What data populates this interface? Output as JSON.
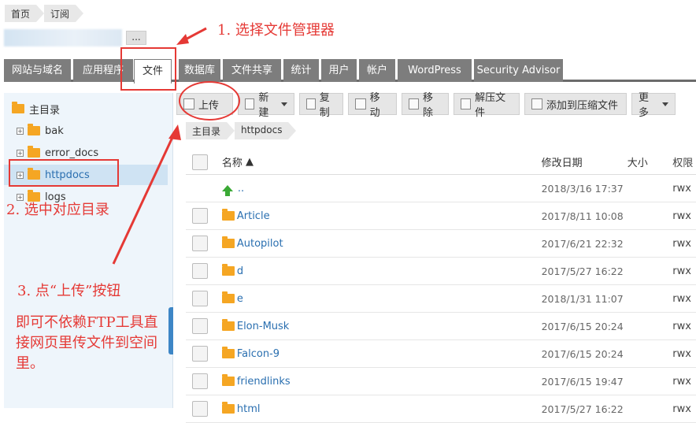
{
  "breadcrumb": [
    "首页",
    "订阅"
  ],
  "domain_more": "...",
  "tabs": [
    "网站与域名",
    "应用程序",
    "文件",
    "数据库",
    "文件共享",
    "统计",
    "用户",
    "帐户",
    "WordPress",
    "Security Advisor"
  ],
  "active_tab": "文件",
  "tree": {
    "root": "主目录",
    "items": [
      {
        "label": "bak"
      },
      {
        "label": "error_docs"
      },
      {
        "label": "httpdocs"
      },
      {
        "label": "logs"
      }
    ]
  },
  "toolbar": {
    "upload": "上传",
    "new": "新建",
    "copy": "复制",
    "move": "移动",
    "remove": "移除",
    "extract": "解压文件",
    "archive": "添加到压缩文件",
    "more": "更多"
  },
  "path": [
    "主目录",
    "httpdocs"
  ],
  "columns": {
    "name": "名称",
    "date": "修改日期",
    "size": "大小",
    "perm": "权限"
  },
  "rows": [
    {
      "name": "..",
      "date": "2018/3/16 17:37",
      "perm": "rwx"
    },
    {
      "name": "Article",
      "date": "2017/8/11 10:08",
      "perm": "rwx"
    },
    {
      "name": "Autopilot",
      "date": "2017/6/21 22:32",
      "perm": "rwx"
    },
    {
      "name": "d",
      "date": "2017/5/27 16:22",
      "perm": "rwx"
    },
    {
      "name": "e",
      "date": "2018/1/31 11:07",
      "perm": "rwx"
    },
    {
      "name": "Elon-Musk",
      "date": "2017/6/15 20:24",
      "perm": "rwx"
    },
    {
      "name": "Falcon-9",
      "date": "2017/6/15 20:24",
      "perm": "rwx"
    },
    {
      "name": "friendlinks",
      "date": "2017/6/15 19:47",
      "perm": "rwx"
    },
    {
      "name": "html",
      "date": "2017/5/27 16:22",
      "perm": "rwx"
    }
  ],
  "annotations": {
    "step1": "1. 选择文件管理器",
    "step2": "2. 选中对应目录",
    "step3": "3. 点“上传”按钮",
    "note": "即可不依赖FTP工具直接网页里传文件到空间里。"
  },
  "colors": {
    "annotation": "#e53935",
    "tab_bg": "#7d7d7d",
    "link": "#2a6fb0",
    "folder": "#f5a623"
  }
}
